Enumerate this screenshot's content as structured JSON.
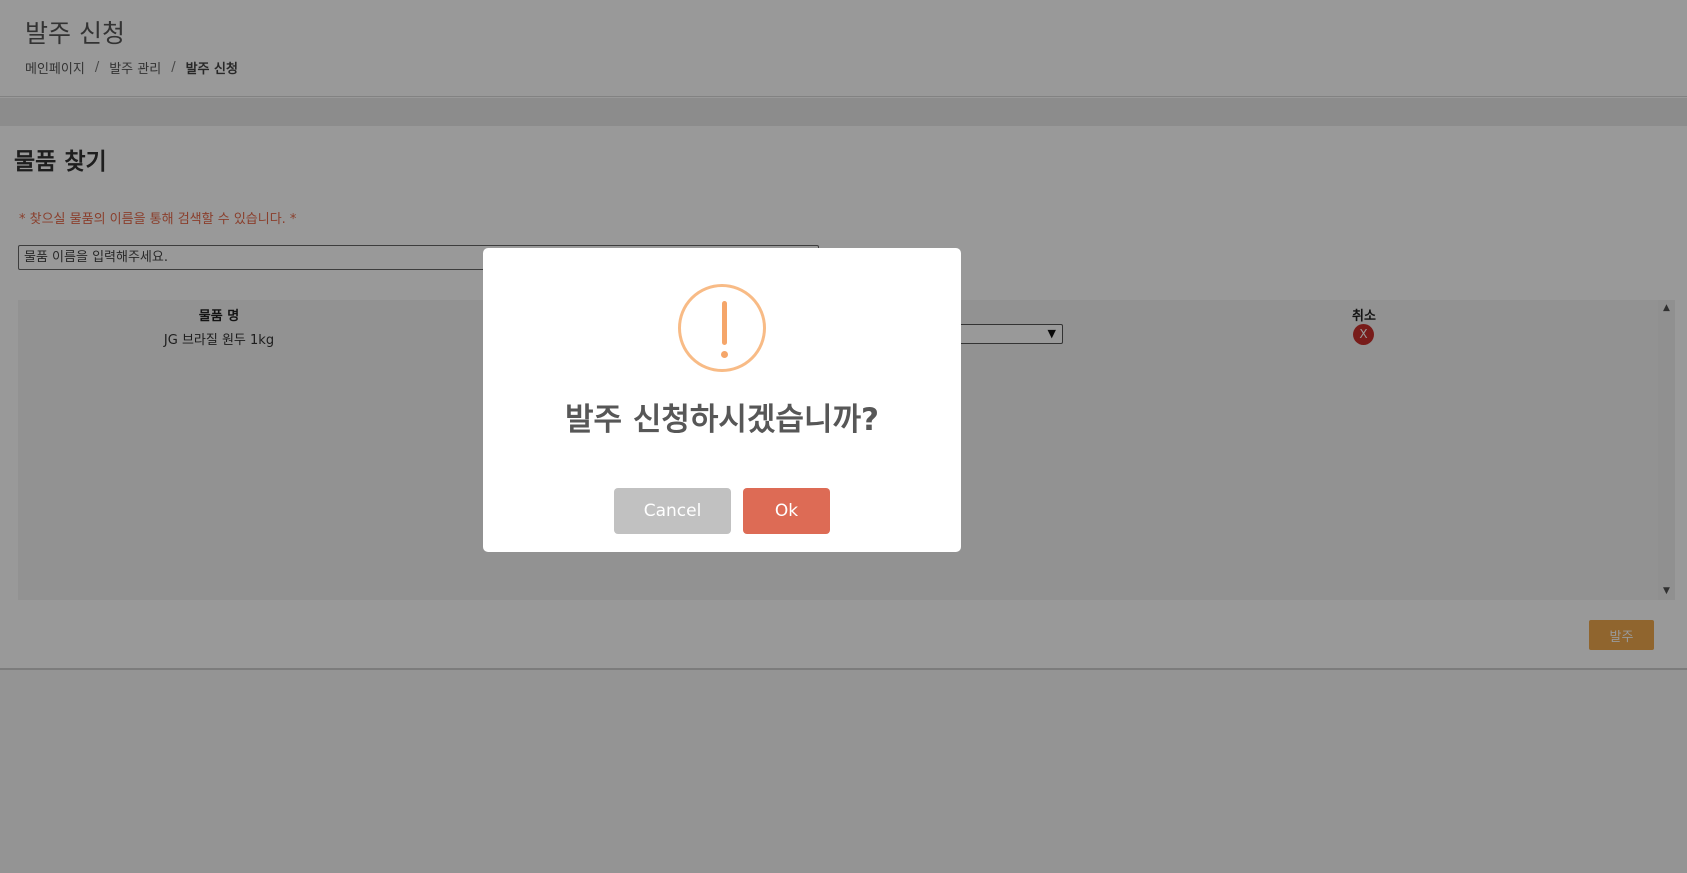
{
  "header": {
    "title": "발주 신청",
    "breadcrumb": [
      "메인페이지",
      "발주 관리",
      "발주 신청"
    ],
    "separator": "/"
  },
  "search_section": {
    "title": "물품 찾기",
    "hint": "* 찾으실 물품의 이름을 통해 검색할 수 있습니다. *",
    "input_placeholder": "물품 이름을 입력해주세요.",
    "input_value": ""
  },
  "table": {
    "headers": {
      "name": "물품 명",
      "cancel": "취소"
    },
    "rows": [
      {
        "name": "JG 브라질 원두 1kg",
        "remove_label": "X"
      }
    ]
  },
  "order_button": "발주",
  "modal": {
    "icon": "warning-icon",
    "title": "발주 신청하시겠습니까?",
    "cancel_label": "Cancel",
    "ok_label": "Ok"
  },
  "colors": {
    "accent_orange": "#f0a84e",
    "hint_red": "#e66a4b",
    "ok_button": "#dd6b55",
    "cancel_button": "#c1c1c1",
    "warning_ring": "#f8bb86",
    "remove_red": "#c9302c"
  }
}
